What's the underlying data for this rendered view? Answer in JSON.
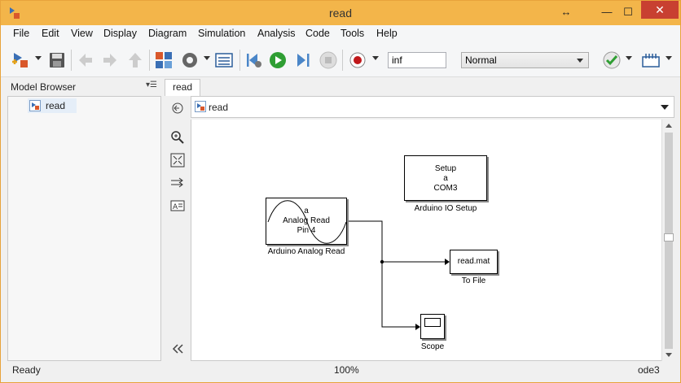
{
  "window": {
    "title": "read"
  },
  "menu": [
    "File",
    "Edit",
    "View",
    "Display",
    "Diagram",
    "Simulation",
    "Analysis",
    "Code",
    "Tools",
    "Help"
  ],
  "toolbar": {
    "stop_time": "inf",
    "sim_mode": "Normal"
  },
  "model_browser": {
    "title": "Model Browser",
    "tree_root": "read"
  },
  "tab": {
    "label": "read"
  },
  "address": {
    "path": "read"
  },
  "blocks": {
    "setup": {
      "lines": [
        "Setup",
        "a",
        "COM3"
      ],
      "caption": "Arduino IO Setup"
    },
    "analog": {
      "lines": [
        "a",
        "Analog Read",
        "Pin 4"
      ],
      "caption": "Arduino Analog Read"
    },
    "tofile": {
      "text": "read.mat",
      "caption": "To File"
    },
    "scope": {
      "caption": "Scope"
    }
  },
  "status": {
    "left": "Ready",
    "zoom": "100%",
    "solver": "ode3"
  },
  "colors": {
    "titlebar": "#f3b54a",
    "close": "#c84031",
    "run_green": "#2f9e33",
    "record_red": "#c0181b"
  }
}
